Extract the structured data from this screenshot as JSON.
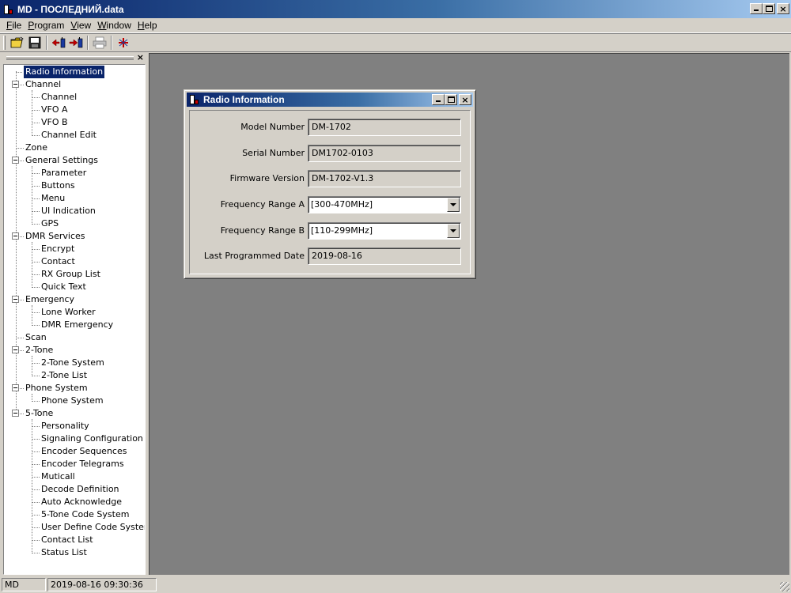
{
  "window": {
    "title": "MD - ПОСЛЕДНИЙ.data",
    "min_label": "_",
    "max_label": "□",
    "close_label": "×"
  },
  "menu": {
    "items": [
      {
        "label": "File"
      },
      {
        "label": "Program"
      },
      {
        "label": "View"
      },
      {
        "label": "Window"
      },
      {
        "label": "Help"
      }
    ]
  },
  "toolbar": {
    "buttons": [
      {
        "icon": "open-folder-icon"
      },
      {
        "icon": "save-disk-icon"
      },
      {
        "icon": "read-from-radio-icon"
      },
      {
        "icon": "write-to-radio-icon"
      },
      {
        "icon": "print-icon"
      },
      {
        "icon": "about-icon"
      }
    ]
  },
  "pane": {
    "close_label": "×"
  },
  "tree": {
    "nodes": [
      {
        "label": "Radio Information",
        "level": 0,
        "expandable": false,
        "selected": true
      },
      {
        "label": "Channel",
        "level": 0,
        "expandable": true
      },
      {
        "label": "Channel",
        "level": 1
      },
      {
        "label": "VFO A",
        "level": 1
      },
      {
        "label": "VFO B",
        "level": 1
      },
      {
        "label": "Channel Edit",
        "level": 1
      },
      {
        "label": "Zone",
        "level": 0,
        "expandable": false
      },
      {
        "label": "General Settings",
        "level": 0,
        "expandable": true
      },
      {
        "label": "Parameter",
        "level": 1
      },
      {
        "label": "Buttons",
        "level": 1
      },
      {
        "label": "Menu",
        "level": 1
      },
      {
        "label": "UI Indication",
        "level": 1
      },
      {
        "label": "GPS",
        "level": 1
      },
      {
        "label": "DMR Services",
        "level": 0,
        "expandable": true
      },
      {
        "label": "Encrypt",
        "level": 1
      },
      {
        "label": "Contact",
        "level": 1
      },
      {
        "label": "RX Group List",
        "level": 1
      },
      {
        "label": "Quick Text",
        "level": 1
      },
      {
        "label": "Emergency",
        "level": 0,
        "expandable": true
      },
      {
        "label": "Lone Worker",
        "level": 1
      },
      {
        "label": "DMR Emergency",
        "level": 1
      },
      {
        "label": "Scan",
        "level": 0,
        "expandable": false
      },
      {
        "label": "2-Tone",
        "level": 0,
        "expandable": true
      },
      {
        "label": "2-Tone System",
        "level": 1
      },
      {
        "label": "2-Tone List",
        "level": 1
      },
      {
        "label": "Phone System",
        "level": 0,
        "expandable": true
      },
      {
        "label": "Phone System",
        "level": 1
      },
      {
        "label": "5-Tone",
        "level": 0,
        "expandable": true
      },
      {
        "label": "Personality",
        "level": 1
      },
      {
        "label": "Signaling Configuration",
        "level": 1
      },
      {
        "label": "Encoder Sequences",
        "level": 1
      },
      {
        "label": "Encoder Telegrams",
        "level": 1
      },
      {
        "label": "Muticall",
        "level": 1
      },
      {
        "label": "Decode Definition",
        "level": 1
      },
      {
        "label": "Auto Acknowledge",
        "level": 1
      },
      {
        "label": "5-Tone Code System",
        "level": 1
      },
      {
        "label": "User Define Code System",
        "level": 1
      },
      {
        "label": "Contact List",
        "level": 1
      },
      {
        "label": "Status List",
        "level": 1
      }
    ]
  },
  "radio_info": {
    "title": "Radio Information",
    "fields": {
      "model_number": {
        "label": "Model Number",
        "value": "DM-1702"
      },
      "serial_number": {
        "label": "Serial Number",
        "value": "DM1702-0103"
      },
      "firmware_version": {
        "label": "Firmware Version",
        "value": "DM-1702-V1.3"
      },
      "frequency_range_a": {
        "label": "Frequency Range A",
        "value": "[300-470MHz]"
      },
      "frequency_range_b": {
        "label": "Frequency Range B",
        "value": "[110-299MHz]"
      },
      "last_programmed_date": {
        "label": "Last Programmed Date",
        "value": "2019-08-16"
      }
    }
  },
  "status": {
    "mode": "MD",
    "datetime": "2019-08-16 09:30:36"
  }
}
